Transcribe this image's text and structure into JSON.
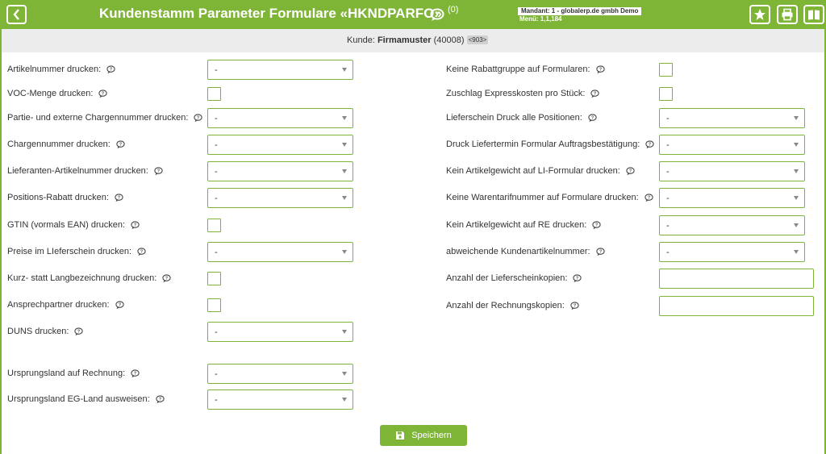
{
  "header": {
    "title": "Kundenstamm Parameter Formulare «HKNDPARFO»",
    "comment_count": "(0)",
    "mandant": "Mandant: 1 - globalerp.de gmbh Demo",
    "menu": "Menü: 1,1,184",
    "icons": [
      "back-icon",
      "chat-icon",
      "star-icon",
      "print-icon",
      "book-icon"
    ]
  },
  "customer": {
    "prefix": "Kunde:",
    "name": "Firmamuster",
    "number": "(40008)",
    "badge": "<903>"
  },
  "left_fields": [
    {
      "label": "Artikelnummer drucken:",
      "type": "select",
      "value": "-"
    },
    {
      "label": "VOC-Menge drucken:",
      "type": "checkbox"
    },
    {
      "label": "Partie- und externe Chargennummer drucken:",
      "type": "select",
      "value": "-"
    },
    {
      "label": "Chargennummer drucken:",
      "type": "select",
      "value": "-"
    },
    {
      "label": "Lieferanten-Artikelnummer drucken:",
      "type": "select",
      "value": "-"
    },
    {
      "label": "Positions-Rabatt drucken:",
      "type": "select",
      "value": "-"
    },
    {
      "label": "GTIN (vormals EAN) drucken:",
      "type": "checkbox"
    },
    {
      "label": "Preise im LIeferschein drucken:",
      "type": "select",
      "value": "-"
    },
    {
      "label": "Kurz- statt Langbezeichnung drucken:",
      "type": "checkbox"
    },
    {
      "label": "Ansprechpartner drucken:",
      "type": "checkbox"
    },
    {
      "label": "DUNS drucken:",
      "type": "select",
      "value": "-"
    },
    {
      "label": "Ursprungsland auf Rechnung:",
      "type": "select",
      "value": "-"
    },
    {
      "label": "Ursprungsland EG-Land ausweisen:",
      "type": "select",
      "value": "-"
    }
  ],
  "right_fields": [
    {
      "label": "Keine Rabattgruppe auf Formularen:",
      "type": "checkbox"
    },
    {
      "label": "Zuschlag Expresskosten pro Stück:",
      "type": "checkbox"
    },
    {
      "label": "Lieferschein Druck alle Positionen:",
      "type": "select",
      "value": "-"
    },
    {
      "label": "Druck Liefertermin Formular Auftragsbestätigung:",
      "type": "select",
      "value": "-"
    },
    {
      "label": "Kein Artikelgewicht auf LI-Formular drucken:",
      "type": "select",
      "value": "-"
    },
    {
      "label": "Keine Warentarifnummer auf Formulare drucken:",
      "type": "select",
      "value": "-"
    },
    {
      "label": "Kein Artikelgewicht auf RE drucken:",
      "type": "select",
      "value": "-"
    },
    {
      "label": "abweichende Kundenartikelnummer:",
      "type": "select",
      "value": "-"
    },
    {
      "label": "Anzahl der Lieferscheinkopien:",
      "type": "text",
      "value": ""
    },
    {
      "label": "Anzahl der Rechnungskopien:",
      "type": "text",
      "value": ""
    }
  ],
  "save_label": "Speichern",
  "colors": {
    "accent": "#7fb536",
    "subbar": "#ececec",
    "text": "#333333"
  }
}
